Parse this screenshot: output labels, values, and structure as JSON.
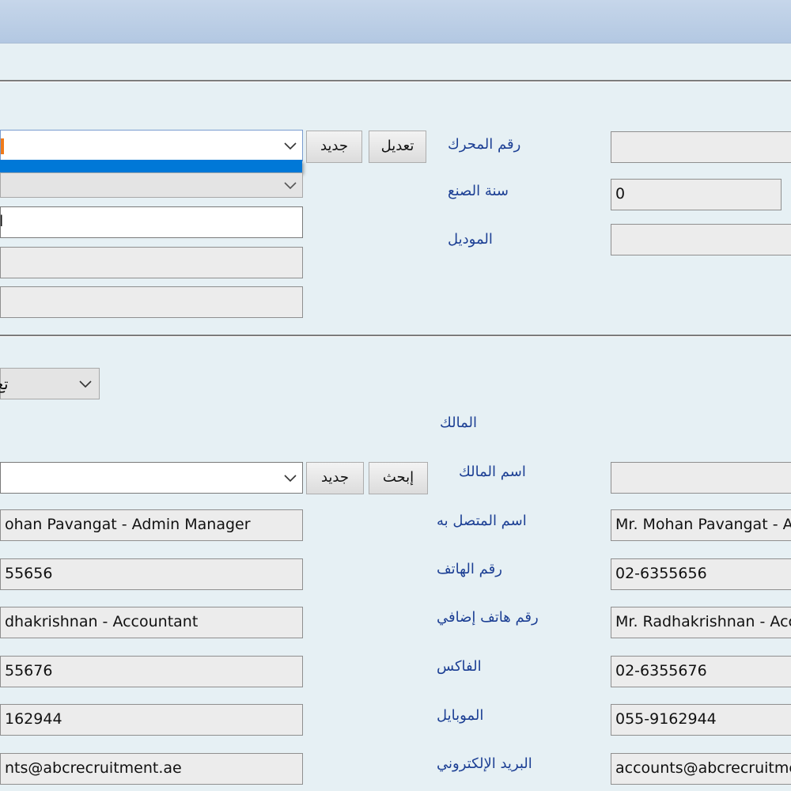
{
  "vehicle": {
    "engine_no_label": "رقم المحرك",
    "year_label": "سنة الصنع",
    "model_label": "الموديل",
    "year_value": "0",
    "edit_button": "تعديل",
    "new_button": "جديد",
    "combo_partial_text": "ا"
  },
  "owner_section": {
    "type_combo_text": "تع",
    "owner_heading": "المالك",
    "owner_name_label": "اسم المالك",
    "search_button": "إبحث",
    "new_button": "جديد",
    "rows": [
      {
        "label": "اسم المتصل به",
        "left_value": "ohan Pavangat - Admin Manager",
        "right_value": "Mr. Mohan Pavangat - A"
      },
      {
        "label": "رقم الهاتف",
        "left_value": "55656",
        "right_value": "02-6355656"
      },
      {
        "label": "رقم هاتف إضافي",
        "left_value": "dhakrishnan - Accountant",
        "right_value": "Mr. Radhakrishnan - Acc"
      },
      {
        "label": "الفاكس",
        "left_value": "55676",
        "right_value": "02-6355676"
      },
      {
        "label": "الموبايل",
        "left_value": "162944",
        "right_value": "055-9162944"
      },
      {
        "label": "البريد الإلكتروني",
        "left_value": "nts@abcrecruitment.ae",
        "right_value": "accounts@abcrecruitme"
      }
    ]
  },
  "colors": {
    "accent": "#0078d7",
    "label": "#1c3f94",
    "background": "#e6f0f4"
  }
}
